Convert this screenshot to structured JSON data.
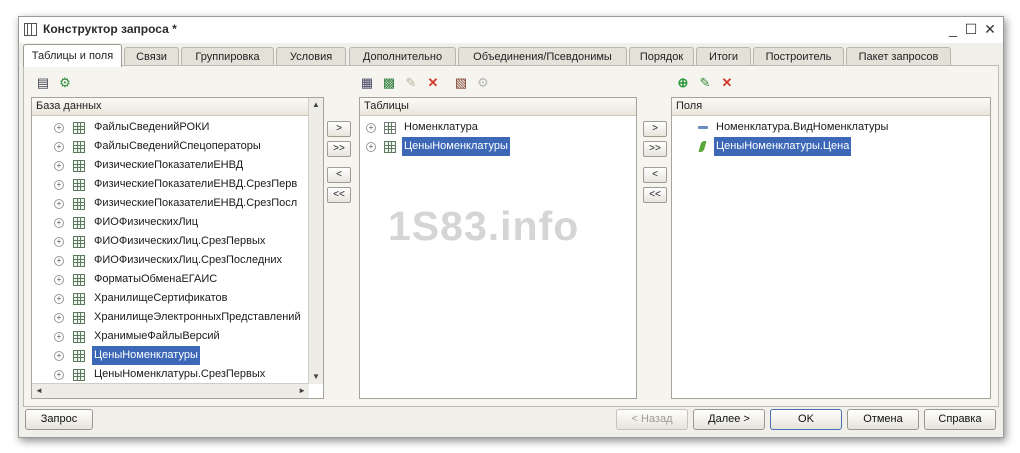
{
  "window": {
    "title": "Конструктор запроса *",
    "minimize_glyph": "_",
    "maximize_glyph": "☐",
    "close_glyph": "✕"
  },
  "tabs": [
    {
      "label": "Таблицы и поля",
      "active": true
    },
    {
      "label": "Связи"
    },
    {
      "label": "Группировка"
    },
    {
      "label": "Условия"
    },
    {
      "label": "Дополнительно"
    },
    {
      "label": "Объединения/Псевдонимы"
    },
    {
      "label": "Порядок"
    },
    {
      "label": "Итоги"
    },
    {
      "label": "Построитель"
    },
    {
      "label": "Пакет запросов"
    }
  ],
  "database_panel": {
    "header": "База данных",
    "items": [
      {
        "label": "ФайлыСведенийРОКИ"
      },
      {
        "label": "ФайлыСведенийСпецоператоры"
      },
      {
        "label": "ФизическиеПоказателиЕНВД"
      },
      {
        "label": "ФизическиеПоказателиЕНВД.СрезПерв"
      },
      {
        "label": "ФизическиеПоказателиЕНВД.СрезПосл"
      },
      {
        "label": "ФИОФизическихЛиц"
      },
      {
        "label": "ФИОФизическихЛиц.СрезПервых"
      },
      {
        "label": "ФИОФизическихЛиц.СрезПоследних"
      },
      {
        "label": "ФорматыОбменаЕГАИС"
      },
      {
        "label": "ХранилищеСертификатов"
      },
      {
        "label": "ХранилищеЭлектронныхПредставлений"
      },
      {
        "label": "ХранимыеФайлыВерсий"
      },
      {
        "label": "ЦеныНоменклатуры",
        "selected": true
      },
      {
        "label": "ЦеныНоменклатуры.СрезПервых"
      }
    ]
  },
  "tables_panel": {
    "header": "Таблицы",
    "items": [
      {
        "label": "Номенклатура"
      },
      {
        "label": "ЦеныНоменклатуры",
        "selected": true
      }
    ]
  },
  "fields_panel": {
    "header": "Поля",
    "items": [
      {
        "label": "Номенклатура.ВидНоменклатуры"
      },
      {
        "label": "ЦеныНоменклатуры.Цена",
        "selected": true
      }
    ]
  },
  "move_buttons": {
    "add": ">",
    "add_all": ">>",
    "remove": "<",
    "remove_all": "<<"
  },
  "watermark": "1S83.info",
  "footer": {
    "query": "Запрос",
    "back": "< Назад",
    "next": "Далее >",
    "ok": "OK",
    "cancel": "Отмена",
    "help": "Справка"
  },
  "colors": {
    "selection": "#3d68b7",
    "window_bg": "#f1efe9"
  }
}
